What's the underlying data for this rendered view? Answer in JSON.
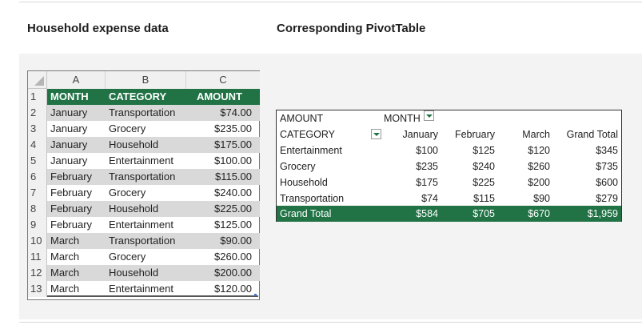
{
  "captions": {
    "left": "Household expense data",
    "right": "Corresponding PivotTable"
  },
  "sheet": {
    "columns": [
      "A",
      "B",
      "C"
    ],
    "row_numbers": [
      "1",
      "2",
      "3",
      "4",
      "5",
      "6",
      "7",
      "8",
      "9",
      "10",
      "11",
      "12",
      "13"
    ],
    "header": {
      "month": "MONTH",
      "category": "CATEGORY",
      "amount": "AMOUNT"
    },
    "rows": [
      {
        "month": "January",
        "category": "Transportation",
        "amount": "$74.00"
      },
      {
        "month": "January",
        "category": "Grocery",
        "amount": "$235.00"
      },
      {
        "month": "January",
        "category": "Household",
        "amount": "$175.00"
      },
      {
        "month": "January",
        "category": "Entertainment",
        "amount": "$100.00"
      },
      {
        "month": "February",
        "category": "Transportation",
        "amount": "$115.00"
      },
      {
        "month": "February",
        "category": "Grocery",
        "amount": "$240.00"
      },
      {
        "month": "February",
        "category": "Household",
        "amount": "$225.00"
      },
      {
        "month": "February",
        "category": "Entertainment",
        "amount": "$125.00"
      },
      {
        "month": "March",
        "category": "Transportation",
        "amount": "$90.00"
      },
      {
        "month": "March",
        "category": "Grocery",
        "amount": "$260.00"
      },
      {
        "month": "March",
        "category": "Household",
        "amount": "$200.00"
      },
      {
        "month": "March",
        "category": "Entertainment",
        "amount": "$120.00"
      }
    ]
  },
  "pivot": {
    "values_label": "AMOUNT",
    "column_field": "MONTH",
    "row_field": "CATEGORY",
    "col_headers": [
      "January",
      "February",
      "March",
      "Grand Total"
    ],
    "rows": [
      {
        "label": "Entertainment",
        "values": [
          "$100",
          "$125",
          "$120",
          "$345"
        ]
      },
      {
        "label": "Grocery",
        "values": [
          "$235",
          "$240",
          "$260",
          "$735"
        ]
      },
      {
        "label": "Household",
        "values": [
          "$175",
          "$225",
          "$200",
          "$600"
        ]
      },
      {
        "label": "Transportation",
        "values": [
          "$74",
          "$115",
          "$90",
          "$279"
        ]
      }
    ],
    "grand_total": {
      "label": "Grand Total",
      "values": [
        "$584",
        "$705",
        "$670",
        "$1,959"
      ]
    },
    "accent_color": "#217346",
    "band_color": "#d9d9d9"
  }
}
